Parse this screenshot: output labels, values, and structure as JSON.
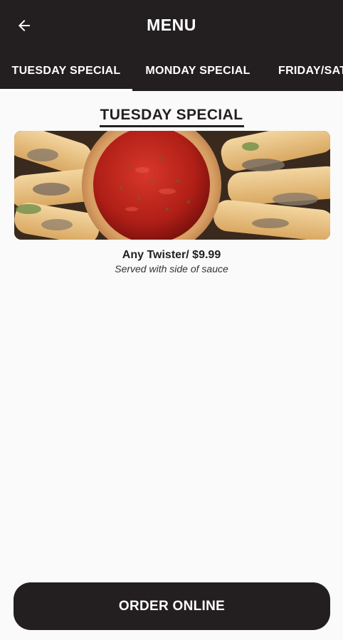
{
  "header": {
    "back_icon": "arrow-left-icon",
    "title": "MENU"
  },
  "tabs": [
    {
      "label": "TUESDAY SPECIAL",
      "active": true
    },
    {
      "label": "MONDAY SPECIAL",
      "active": false
    },
    {
      "label": "FRIDAY/SAT",
      "active": false
    }
  ],
  "section": {
    "title": "TUESDAY SPECIAL"
  },
  "item": {
    "name": "Any Twister/ $9.99",
    "description": "Served with side of sauce"
  },
  "footer": {
    "order_label": "ORDER ONLINE"
  },
  "colors": {
    "bar": "#231f20",
    "background": "#fafafa",
    "text": "#231f20",
    "on_dark": "#ffffff"
  }
}
